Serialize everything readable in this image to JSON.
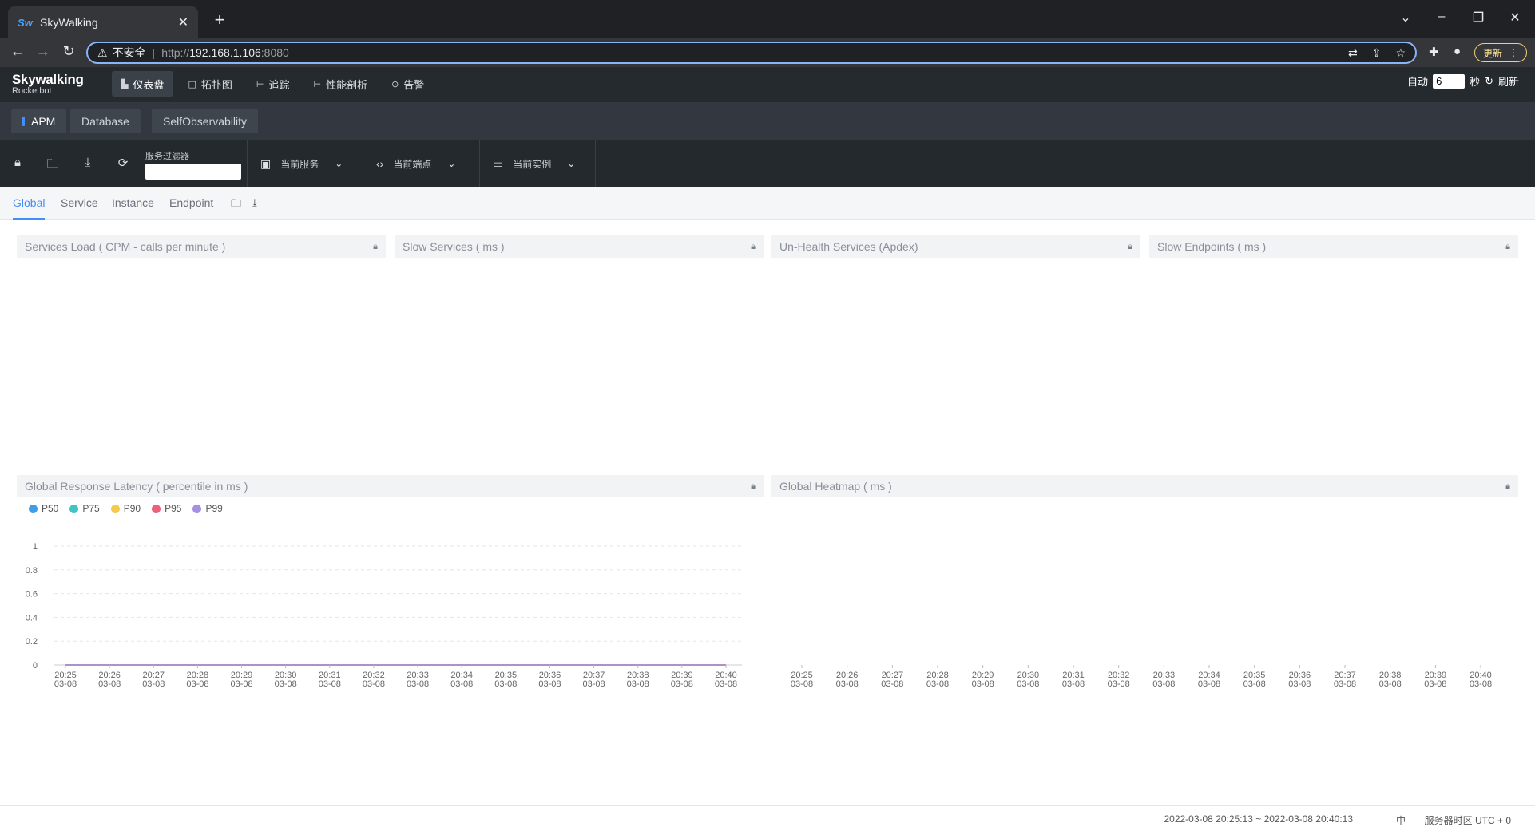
{
  "browser": {
    "tab_title": "SkyWalking",
    "favicon": "Sw",
    "close_glyph": "✕",
    "new_tab_glyph": "+",
    "insecure_label": "不安全",
    "url_protocol": "http://",
    "url_host": "192.168.1.106",
    "url_port": ":8080",
    "update_label": "更新"
  },
  "app": {
    "brand": "Skywalking",
    "brand_sub": "Rocketbot",
    "nav": [
      {
        "label": "仪表盘",
        "icon": "dashboard-icon"
      },
      {
        "label": "拓扑图",
        "icon": "topology-icon"
      },
      {
        "label": "追踪",
        "icon": "trace-icon"
      },
      {
        "label": "性能剖析",
        "icon": "profile-icon"
      },
      {
        "label": "告警",
        "icon": "alarm-icon"
      }
    ],
    "auto_label": "自动",
    "auto_value": "6",
    "seconds_label": "秒",
    "refresh_label": "刷新"
  },
  "groups": [
    {
      "label": "APM"
    },
    {
      "label": "Database"
    },
    {
      "label": "SelfObservability"
    }
  ],
  "toolbar": {
    "filter_label": "服务过滤器",
    "filter_value": "",
    "service_label": "当前服务",
    "endpoint_label": "当前端点",
    "instance_label": "当前实例"
  },
  "tabs": [
    {
      "label": "Global"
    },
    {
      "label": "Service"
    },
    {
      "label": "Instance"
    },
    {
      "label": "Endpoint"
    }
  ],
  "panels": {
    "services_load": "Services Load ( CPM - calls per minute )",
    "slow_services": "Slow Services ( ms )",
    "unhealth_services": "Un-Health Services (Apdex)",
    "slow_endpoints": "Slow Endpoints ( ms )",
    "global_latency": "Global Response Latency ( percentile in ms )",
    "global_heatmap": "Global Heatmap ( ms )"
  },
  "chart_data": [
    {
      "type": "line",
      "title": "Global Response Latency ( percentile in ms )",
      "legend_position": "top-left",
      "categories": [
        "20:25\n03-08",
        "20:26\n03-08",
        "20:27\n03-08",
        "20:28\n03-08",
        "20:29\n03-08",
        "20:30\n03-08",
        "20:31\n03-08",
        "20:32\n03-08",
        "20:33\n03-08",
        "20:34\n03-08",
        "20:35\n03-08",
        "20:36\n03-08",
        "20:37\n03-08",
        "20:38\n03-08",
        "20:39\n03-08",
        "20:40\n03-08"
      ],
      "yticks": [
        "0",
        "0.2",
        "0.4",
        "0.6",
        "0.8",
        "1"
      ],
      "ylim": [
        0,
        1
      ],
      "grid": true,
      "series": [
        {
          "name": "P50",
          "color": "#3f9ee8",
          "values": [
            0,
            0,
            0,
            0,
            0,
            0,
            0,
            0,
            0,
            0,
            0,
            0,
            0,
            0,
            0,
            0
          ]
        },
        {
          "name": "P75",
          "color": "#3ec4c4",
          "values": [
            0,
            0,
            0,
            0,
            0,
            0,
            0,
            0,
            0,
            0,
            0,
            0,
            0,
            0,
            0,
            0
          ]
        },
        {
          "name": "P90",
          "color": "#f7c94b",
          "values": [
            0,
            0,
            0,
            0,
            0,
            0,
            0,
            0,
            0,
            0,
            0,
            0,
            0,
            0,
            0,
            0
          ]
        },
        {
          "name": "P95",
          "color": "#ee5f7a",
          "values": [
            0,
            0,
            0,
            0,
            0,
            0,
            0,
            0,
            0,
            0,
            0,
            0,
            0,
            0,
            0,
            0
          ]
        },
        {
          "name": "P99",
          "color": "#a48fe0",
          "values": [
            0,
            0,
            0,
            0,
            0,
            0,
            0,
            0,
            0,
            0,
            0,
            0,
            0,
            0,
            0,
            0
          ]
        }
      ]
    },
    {
      "type": "heatmap",
      "title": "Global Heatmap ( ms )",
      "categories": [
        "20:25\n03-08",
        "20:26\n03-08",
        "20:27\n03-08",
        "20:28\n03-08",
        "20:29\n03-08",
        "20:30\n03-08",
        "20:31\n03-08",
        "20:32\n03-08",
        "20:33\n03-08",
        "20:34\n03-08",
        "20:35\n03-08",
        "20:36\n03-08",
        "20:37\n03-08",
        "20:38\n03-08",
        "20:39\n03-08",
        "20:40\n03-08"
      ],
      "values": []
    }
  ],
  "footer": {
    "time_range": "2022-03-08 20:25:13 ~ 2022-03-08 20:40:13",
    "lang": "中",
    "timezone": "服务器时区 UTC + 0"
  },
  "colors": {
    "accent": "#448dfe",
    "header_bg": "#252a2f",
    "toolbar_bg": "#24292e"
  }
}
